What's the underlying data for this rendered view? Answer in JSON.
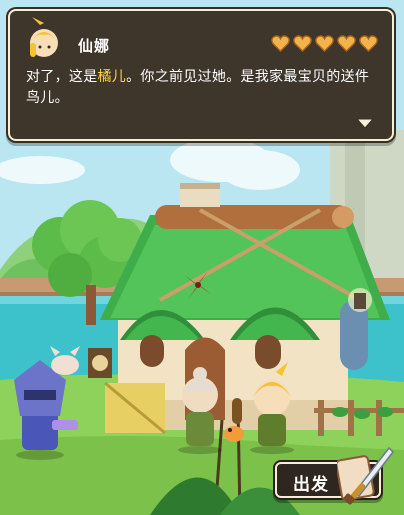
{
  "dialog": {
    "speaker": "仙娜",
    "text_before": "对了，这是",
    "text_highlight": "橘儿",
    "text_after": "。你之前见过她。是我家最宝贝的送件鸟儿。",
    "hearts_total": 5,
    "hearts_filled": 5
  },
  "button": {
    "depart_label": "出发"
  },
  "colors": {
    "dialog_bg": "#3e352b",
    "highlight": "#ffd34d",
    "heart": "#f2b24c"
  }
}
